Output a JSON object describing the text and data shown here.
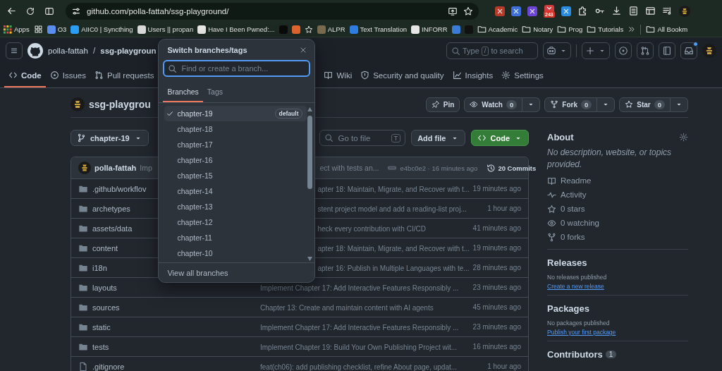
{
  "browser": {
    "url": "github.com/polla-fattah/ssg-playground/",
    "extension_badge": "243",
    "bookmarks": [
      {
        "kind": "apps",
        "label": "Apps"
      },
      {
        "kind": "grid"
      },
      {
        "kind": "site",
        "label": "O3",
        "color": "#5b8def"
      },
      {
        "kind": "site",
        "label": "AIIC0 | Syncthing",
        "color": "#2a9df4"
      },
      {
        "kind": "site",
        "label": "Users || propan",
        "color": "#d8d8d8"
      },
      {
        "kind": "site",
        "label": "Have I Been Pwned:...",
        "color": "#e8e8e8"
      },
      {
        "kind": "site",
        "color": "#0b0b0b"
      },
      {
        "kind": "site",
        "color": "#e0662f"
      },
      {
        "kind": "star"
      },
      {
        "kind": "site",
        "label": "ALPR",
        "color": "#7a6a4f"
      },
      {
        "kind": "site",
        "label": "Text Translation",
        "color": "#2f7de1"
      },
      {
        "kind": "site",
        "label": "INFORR",
        "color": "#e6e6e6"
      },
      {
        "kind": "site",
        "color": "#3a7bd5"
      },
      {
        "kind": "site",
        "color": "#111111"
      },
      {
        "kind": "folder",
        "label": "Academic"
      },
      {
        "kind": "folder",
        "label": "Notary"
      },
      {
        "kind": "folder",
        "label": "Prog"
      },
      {
        "kind": "folder",
        "label": "Tutorials"
      }
    ],
    "all_bookmarks": "All Bookm"
  },
  "header": {
    "owner": "polla-fattah",
    "separator": "/",
    "repo": "ssg-playgroun",
    "search_prefix": "Type",
    "search_key": "/",
    "search_suffix": "to search",
    "inbox_unread": true
  },
  "nav": {
    "tabs_before_dialog": [
      {
        "kind": "code",
        "label": "Code",
        "selected": true
      },
      {
        "kind": "issues",
        "label": "Issues",
        "selected": false
      },
      {
        "kind": "pulls",
        "label": "Pull requests",
        "selected": false
      }
    ],
    "tabs_after_dialog": [
      {
        "kind": "wiki",
        "label": "Wiki",
        "selected": false
      },
      {
        "kind": "security",
        "label": "Security and quality",
        "selected": false
      },
      {
        "kind": "insights",
        "label": "Insights",
        "selected": false
      },
      {
        "kind": "settings",
        "label": "Settings",
        "selected": false
      }
    ]
  },
  "repo": {
    "name": "ssg-playgrou",
    "pin": "Pin",
    "watch": {
      "label": "Watch",
      "count": "0"
    },
    "fork": {
      "label": "Fork",
      "count": "0"
    },
    "star": {
      "label": "Star",
      "count": "0"
    }
  },
  "toolbar": {
    "branch": "chapter-19",
    "file_search_placeholder": "Go to file",
    "file_search_key": "T",
    "add_file": "Add file",
    "code": "Code"
  },
  "latest_commit": {
    "author": "polla-fattah",
    "message_start": "Imp",
    "message_end": "ect with tests an...",
    "hash_time": "e4bc0e2 · 16 minutes ago",
    "commits": "20 Commits"
  },
  "files": [
    {
      "kind": "folder",
      "name": ".github/workflov",
      "message": "apter 18: Maintain, Migrate, and Recover with t...",
      "time": "19 minutes ago"
    },
    {
      "kind": "folder",
      "name": "archetypes",
      "message": "stent project model and add a reading-list proj...",
      "time": "1 hour ago"
    },
    {
      "kind": "folder",
      "name": "assets/data",
      "message": "heck every contribution with CI/CD",
      "time": "41 minutes ago"
    },
    {
      "kind": "folder",
      "name": "content",
      "message": "apter 18: Maintain, Migrate, and Recover with t...",
      "time": "19 minutes ago"
    },
    {
      "kind": "folder",
      "name": "i18n",
      "message": "apter 16: Publish in Multiple Languages with te...",
      "time": "28 minutes ago"
    },
    {
      "kind": "folder",
      "name": "layouts",
      "message": "Implement Chapter 17: Add Interactive Features Responsibly ...",
      "time": "23 minutes ago"
    },
    {
      "kind": "folder",
      "name": "sources",
      "message": "Chapter 13: Create and maintain content with AI agents",
      "time": "45 minutes ago"
    },
    {
      "kind": "folder",
      "name": "static",
      "message": "Implement Chapter 17: Add Interactive Features Responsibly ...",
      "time": "23 minutes ago"
    },
    {
      "kind": "folder",
      "name": "tests",
      "message": "Implement Chapter 19: Build Your Own Publishing Project wit...",
      "time": "16 minutes ago"
    },
    {
      "kind": "file",
      "name": ".gitignore",
      "message": "feat(ch06): add publishing checklist, refine About page, updat...",
      "time": "1 hour ago"
    }
  ],
  "about": {
    "title": "About",
    "description": "No description, website, or topics provided.",
    "items": [
      {
        "kind": "readme",
        "label": "Readme"
      },
      {
        "kind": "activity",
        "label": "Activity"
      },
      {
        "kind": "stars",
        "label": "0 stars"
      },
      {
        "kind": "watching",
        "label": "0 watching"
      },
      {
        "kind": "forks",
        "label": "0 forks"
      }
    ]
  },
  "releases": {
    "title": "Releases",
    "note": "No releases published",
    "link": "Create a new release"
  },
  "packages": {
    "title": "Packages",
    "note": "No packages published",
    "link": "Publish your first package"
  },
  "contributors": {
    "title": "Contributors",
    "count": "1"
  },
  "popup": {
    "title": "Switch branches/tags",
    "placeholder": "Find or create a branch...",
    "tabs": [
      {
        "label": "Branches",
        "selected": true
      },
      {
        "label": "Tags",
        "selected": false
      }
    ],
    "branches": [
      {
        "name": "chapter-19",
        "selected": true,
        "badge": "default"
      },
      {
        "name": "chapter-18",
        "selected": false
      },
      {
        "name": "chapter-17",
        "selected": false
      },
      {
        "name": "chapter-16",
        "selected": false
      },
      {
        "name": "chapter-15",
        "selected": false
      },
      {
        "name": "chapter-14",
        "selected": false
      },
      {
        "name": "chapter-13",
        "selected": false
      },
      {
        "name": "chapter-12",
        "selected": false
      },
      {
        "name": "chapter-11",
        "selected": false
      },
      {
        "name": "chapter-10",
        "selected": false
      }
    ],
    "footer": "View all branches"
  }
}
